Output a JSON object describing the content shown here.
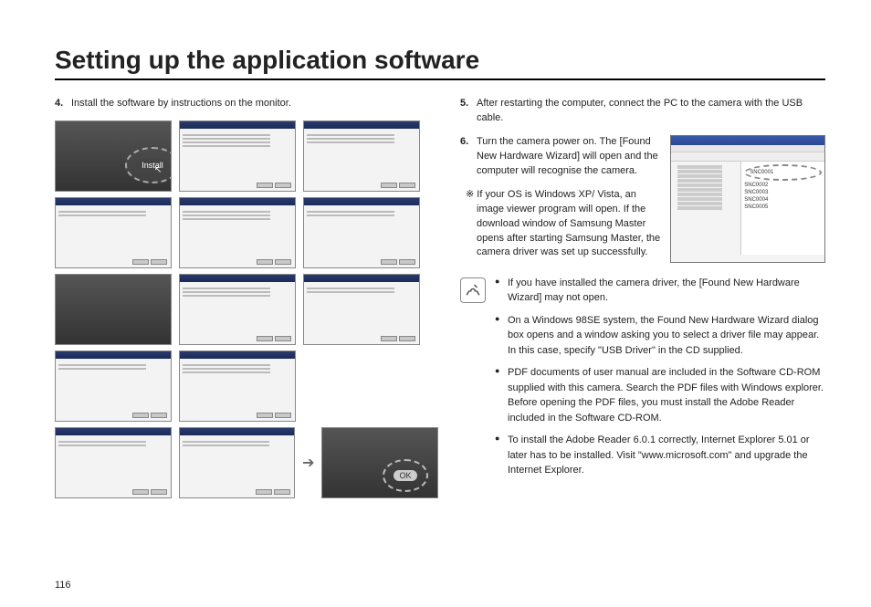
{
  "title": "Setting up the application software",
  "page_number": "116",
  "left": {
    "step4_num": "4.",
    "step4_text": "Install the software by instructions on the monitor.",
    "install_label": "Install",
    "ok_label": "OK"
  },
  "right": {
    "step5_num": "5.",
    "step5_text": "After restarting the computer, connect the PC to the camera with the USB cable.",
    "step6_num": "6.",
    "step6_text": "Turn the camera power on. The [Found New Hardware Wizard] will open and the computer will recognise the camera.",
    "star_marker": "※",
    "star_text": "If your OS is Windows XP/ Vista, an image viewer program will open. If the download window of Samsung Master opens after starting Samsung Master, the camera driver was set up successfully.",
    "notes": [
      "If you have installed the camera driver, the [Found New Hardware Wizard] may not open.",
      "On a Windows 98SE system, the Found New Hardware Wizard dialog box opens and a window asking you to select a driver file may appear. In this case, specify \"USB Driver\" in the CD supplied.",
      "PDF documents of user manual are included in the Software CD-ROM supplied with this camera. Search the PDF files with Windows explorer. Before opening the PDF files, you must install the Adobe Reader included in the Software CD-ROM.",
      "To install the Adobe Reader 6.0.1 correctly, Internet Explorer 5.01 or later has to be installed. Visit \"www.microsoft.com\" and upgrade the Internet Explorer."
    ],
    "explorer_items": [
      "SNC0001",
      "SNC0002",
      "SNC0003",
      "SNC0004",
      "SNC0005"
    ]
  }
}
